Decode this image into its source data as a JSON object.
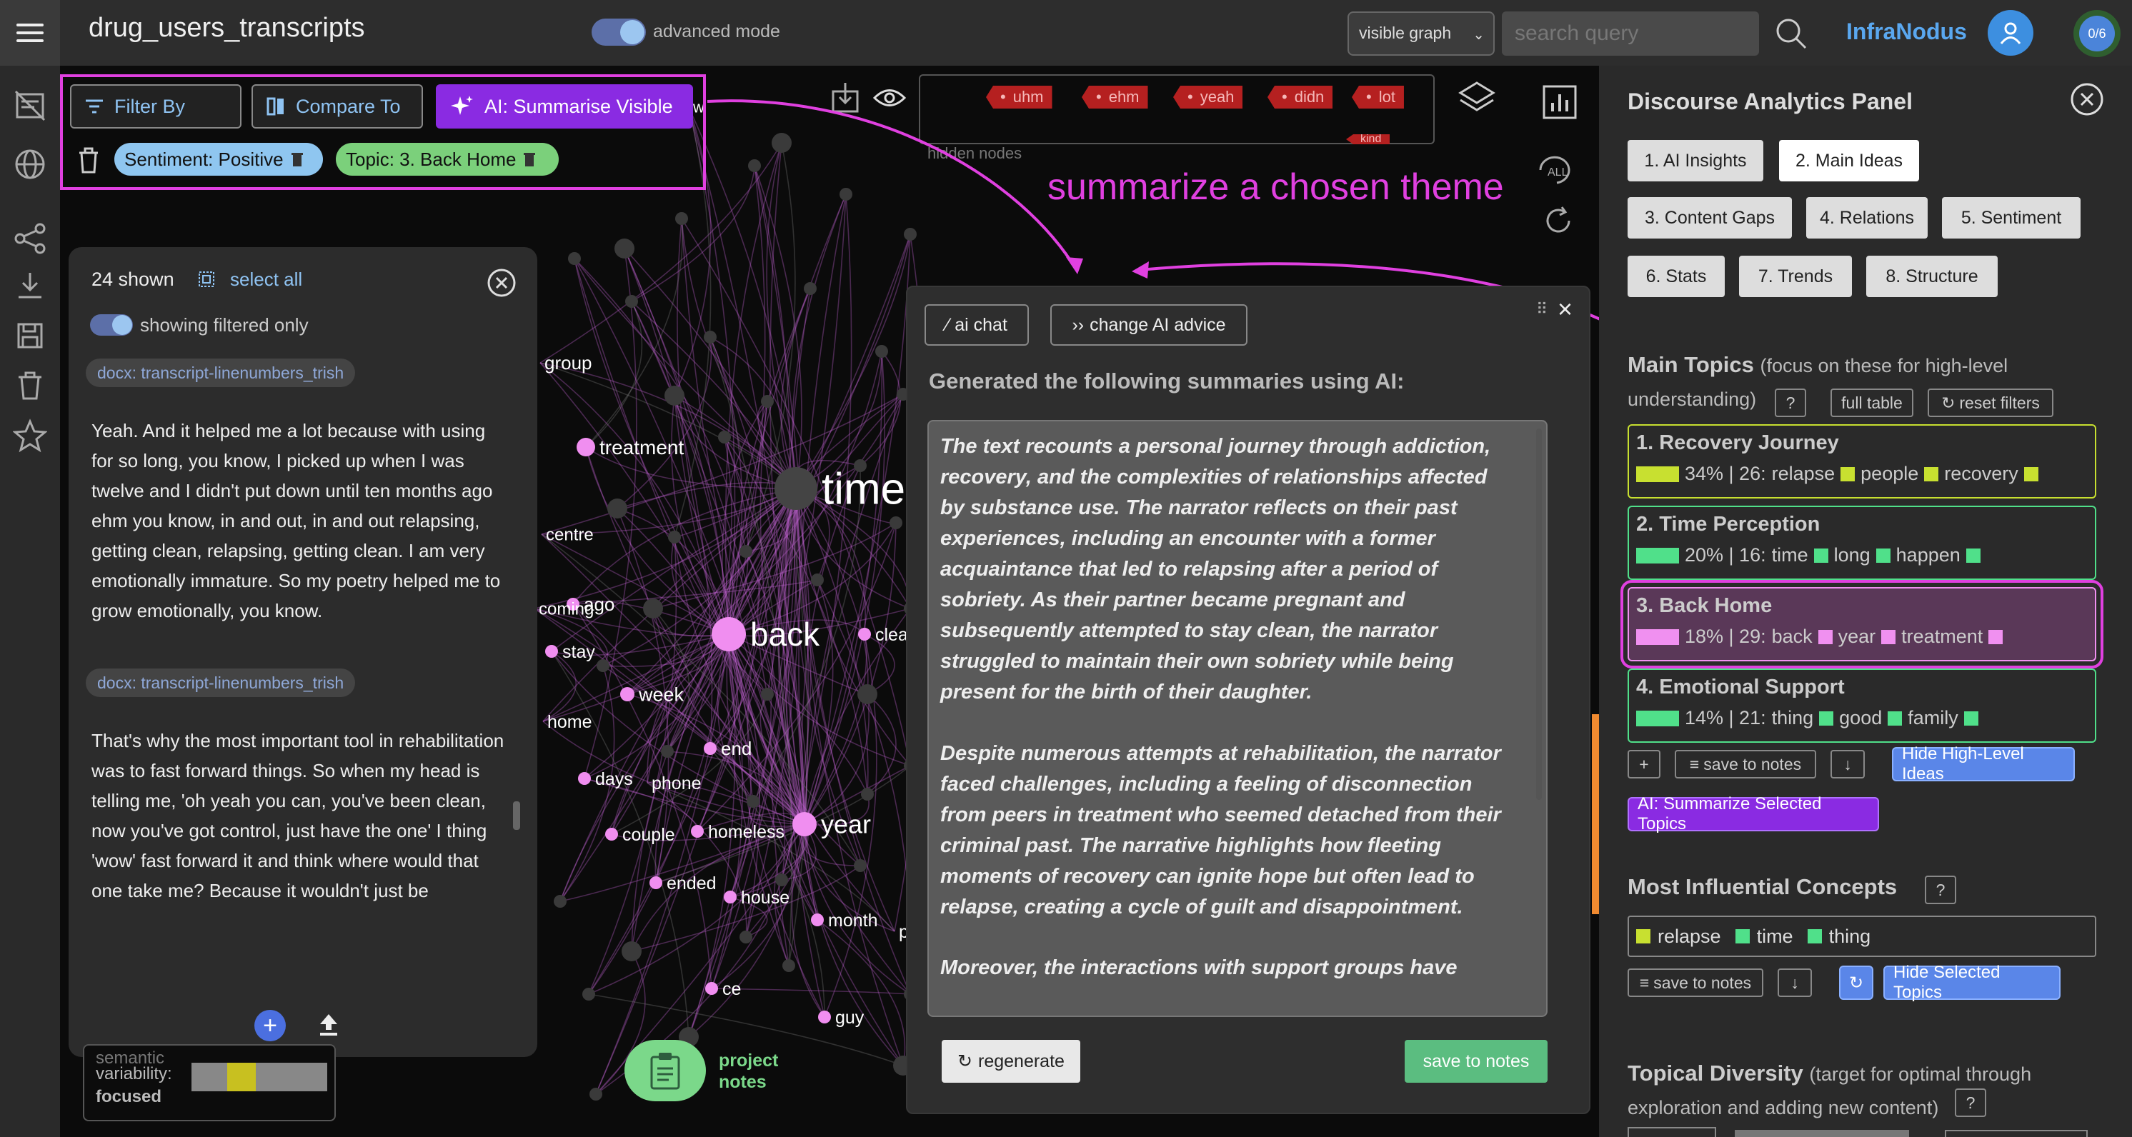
{
  "app": {
    "title": "drug_users_transcripts",
    "advanced_mode_label": "advanced mode"
  },
  "header": {
    "graph_select": "visible graph",
    "search_placeholder": "search query",
    "brand": "InfraNodus",
    "counter": "0/6"
  },
  "toolbar": {
    "filter_by": "Filter By",
    "compare_to": "Compare To",
    "ai_summarise": "AI: Summarise Visible",
    "chips": [
      "Sentiment: Positive",
      "Topic: 3. Back Home"
    ]
  },
  "hidden_nodes": {
    "label": "hidden nodes",
    "tags": [
      "uhm",
      "ehm",
      "yeah",
      "didn",
      "lot",
      "kind"
    ]
  },
  "annotation": "summarize a chosen theme",
  "graph": {
    "labels": [
      "time",
      "back",
      "year",
      "group",
      "treatment",
      "centre",
      "ago",
      "coming",
      "stay",
      "week",
      "home",
      "days",
      "phone",
      "end",
      "couple",
      "homeless",
      "ended",
      "house",
      "month",
      "ce",
      "guy",
      "clea",
      "p",
      "w"
    ]
  },
  "text_panel": {
    "shown": "24 shown",
    "select_all": "select all",
    "filtered_label": "showing filtered only",
    "doc_tag": "docx: transcript-linenumbers_trish",
    "paragraphs": [
      "Yeah. And it helped me a lot because with using for so long, you know, I picked up when I was twelve and I didn't put down until ten months ago ehm you know, in and out, in and out relapsing, getting clean, relapsing, getting clean. I am very emotionally immature. So my poetry helped me to grow emotionally, you know.",
      "That's why the most important tool in rehabilitation was to fast forward things. So when my head is telling me, 'oh yeah you can, you've been clean, now you've got control, just have the one' I thing 'wow' fast forward it and think where would that one take me? Because it wouldn't just be"
    ]
  },
  "variability": {
    "line1": "semantic",
    "line2": "variability:",
    "value": "focused"
  },
  "project_notes": {
    "line1": "project",
    "line2": "notes"
  },
  "ai_modal": {
    "ai_chat": "ai chat",
    "change_advice": "change AI advice",
    "heading": "Generated the following summaries using AI:",
    "paragraphs": [
      "The text recounts a personal journey through addiction, recovery, and the complexities of relationships affected by substance use. The narrator reflects on their past experiences, including an encounter with a former acquaintance that led to relapsing after a period of sobriety. As their partner became pregnant and subsequently attempted to stay clean, the narrator struggled to maintain their own sobriety while being present for the birth of their daughter.",
      "Despite numerous attempts at rehabilitation, the narrator faced challenges, including a feeling of disconnection from peers in treatment who seemed detached from their criminal past. The narrative highlights how fleeting moments of recovery can ignite hope but often lead to relapse, creating a cycle of guilt and disappointment.",
      "Moreover, the interactions with support groups have"
    ],
    "regenerate": "regenerate",
    "save_to_notes": "save to notes"
  },
  "analytics": {
    "title": "Discourse Analytics Panel",
    "tabs": [
      "1. AI Insights",
      "2. Main Ideas",
      "3. Content Gaps",
      "4. Relations",
      "5. Sentiment",
      "6. Stats",
      "7. Trends",
      "8. Structure"
    ],
    "active_tab": "2. Main Ideas",
    "main_topics_title": "Main Topics",
    "main_topics_sub": "(focus on these for high-level understanding)",
    "help": "?",
    "full_table": "full table",
    "reset_filters": "reset filters",
    "topics": [
      {
        "name": "1. Recovery Journey",
        "stats": "34% | 26:",
        "keywords": [
          "relapse",
          "people",
          "recovery"
        ],
        "color": "#c8e030",
        "share": 0.34
      },
      {
        "name": "2. Time Perception",
        "stats": "20% | 16:",
        "keywords": [
          "time",
          "long",
          "happen"
        ],
        "color": "#50e08a",
        "share": 0.2
      },
      {
        "name": "3. Back Home",
        "stats": "18% | 29:",
        "keywords": [
          "back",
          "year",
          "treatment"
        ],
        "color": "#f090f0",
        "share": 0.18
      },
      {
        "name": "4. Emotional Support",
        "stats": "14% | 21:",
        "keywords": [
          "thing",
          "good",
          "family"
        ],
        "color": "#50e08a",
        "share": 0.14
      }
    ],
    "plus": "+",
    "save_to_notes": "save to notes",
    "down": "↓",
    "hide_high_level": "Hide High-Level Ideas",
    "ai_summarize_selected": "AI: Summarize Selected Topics",
    "influential_title": "Most Influential Concepts",
    "concepts": [
      {
        "label": "relapse",
        "color": "#c8e030"
      },
      {
        "label": "time",
        "color": "#50e08a"
      },
      {
        "label": "thing",
        "color": "#50e08a"
      }
    ],
    "hide_selected": "Hide Selected Topics",
    "diversity_title": "Topical Diversity",
    "diversity_sub1": "(target for optimal through",
    "diversity_sub2": "exploration and adding new content)"
  }
}
